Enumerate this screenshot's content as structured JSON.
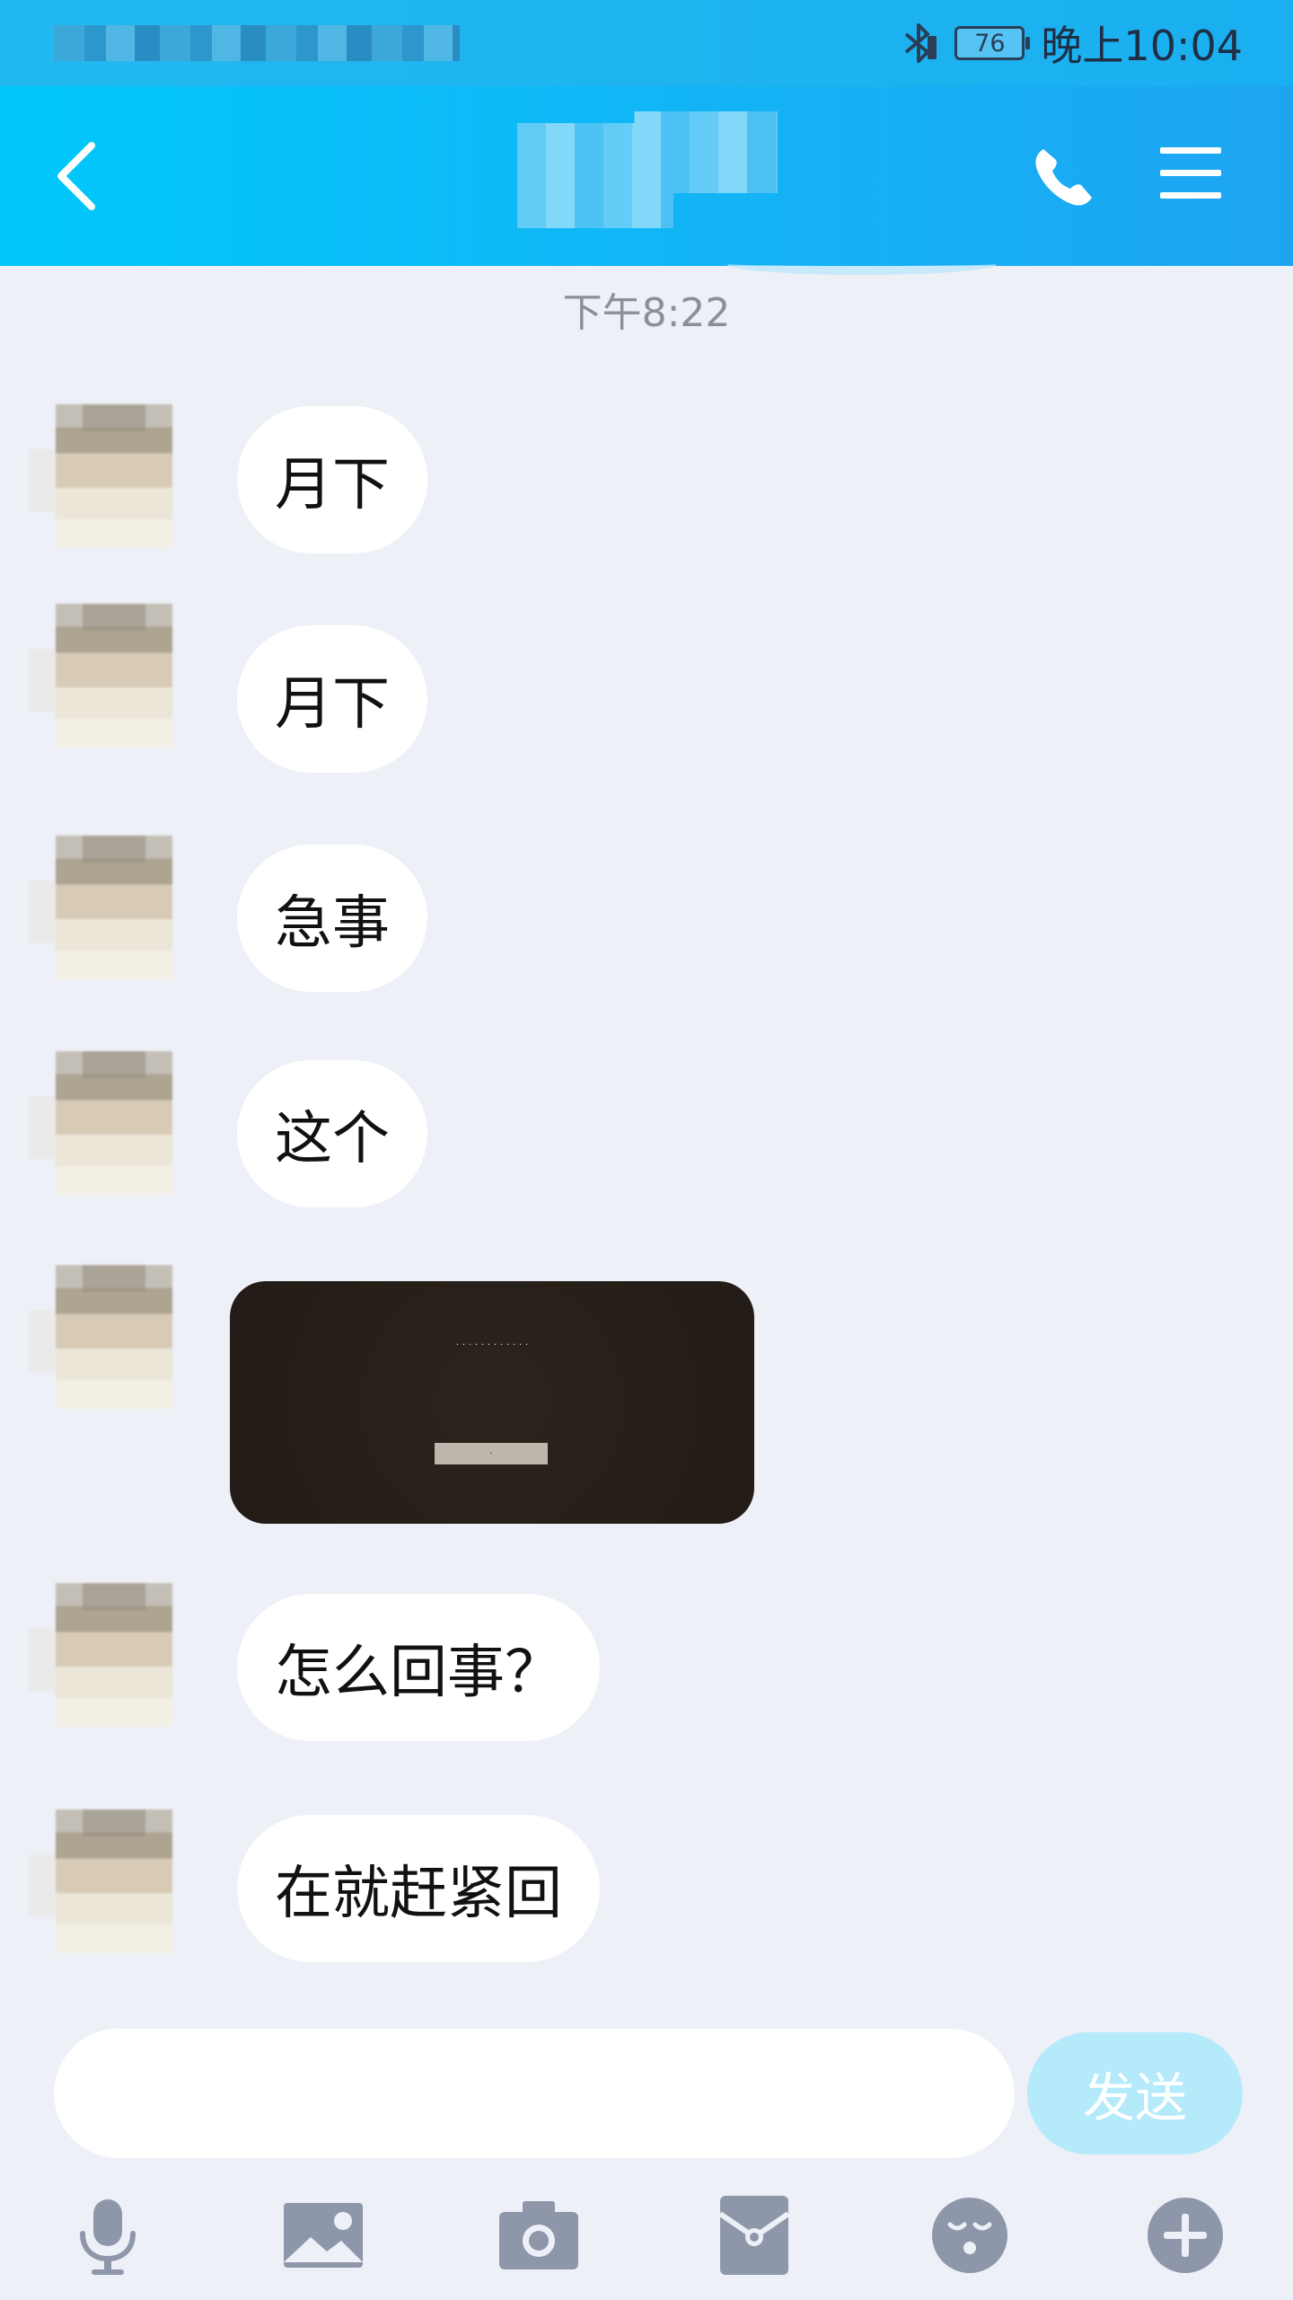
{
  "status_bar": {
    "battery_level": "76",
    "time": "晚上10:04"
  },
  "chat": {
    "timestamp": "下午8:22",
    "messages": [
      {
        "text": "月下"
      },
      {
        "text": "月下"
      },
      {
        "text": "急事"
      },
      {
        "text": "这个"
      },
      {
        "type": "image"
      },
      {
        "text": "怎么回事？"
      },
      {
        "text": "在就赶紧回"
      }
    ]
  },
  "input": {
    "value": "",
    "send_label": "发送"
  },
  "icons": {
    "back": "back-arrow-icon",
    "call": "phone-icon",
    "menu": "menu-icon",
    "voice": "microphone-icon",
    "photo": "image-icon",
    "camera": "camera-icon",
    "red_packet": "red-packet-icon",
    "emoji": "emoji-icon",
    "more": "plus-icon"
  },
  "colors": {
    "nav_start": "#00c8fa",
    "nav_end": "#1ea5f2",
    "send_disabled": "#b5eafb",
    "background": "#eef0f7"
  }
}
